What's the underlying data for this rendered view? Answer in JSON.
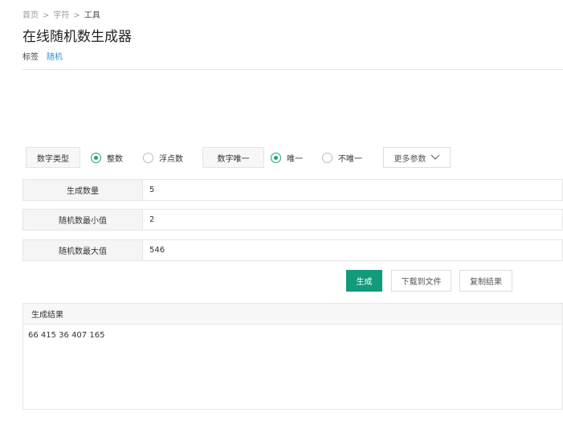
{
  "breadcrumb": {
    "home": "首页",
    "category": "字符",
    "current": "工具",
    "separator": ">"
  },
  "page": {
    "title": "在线随机数生成器",
    "tags_label": "标签",
    "tag": "随机"
  },
  "options": {
    "number_type_label": "数字类型",
    "integer_label": "整数",
    "integer_checked": true,
    "float_label": "浮点数",
    "float_checked": false,
    "unique_label": "数字唯一",
    "unique_yes_label": "唯一",
    "unique_yes_checked": true,
    "unique_no_label": "不唯一",
    "unique_no_checked": false,
    "more_label": "更多参数"
  },
  "fields": {
    "count_label": "生成数量",
    "count_value": "5",
    "min_label": "随机数最小值",
    "min_value": "2",
    "max_label": "随机数最大值",
    "max_value": "546"
  },
  "actions": {
    "generate": "生成",
    "download": "下载到文件",
    "copy": "复制结果"
  },
  "result": {
    "header": "生成结果",
    "text": "66  415  36  407  165"
  },
  "colors": {
    "accent": "#139a7b",
    "link": "#2b8fd6",
    "radio_checked": "#1aa57a"
  }
}
